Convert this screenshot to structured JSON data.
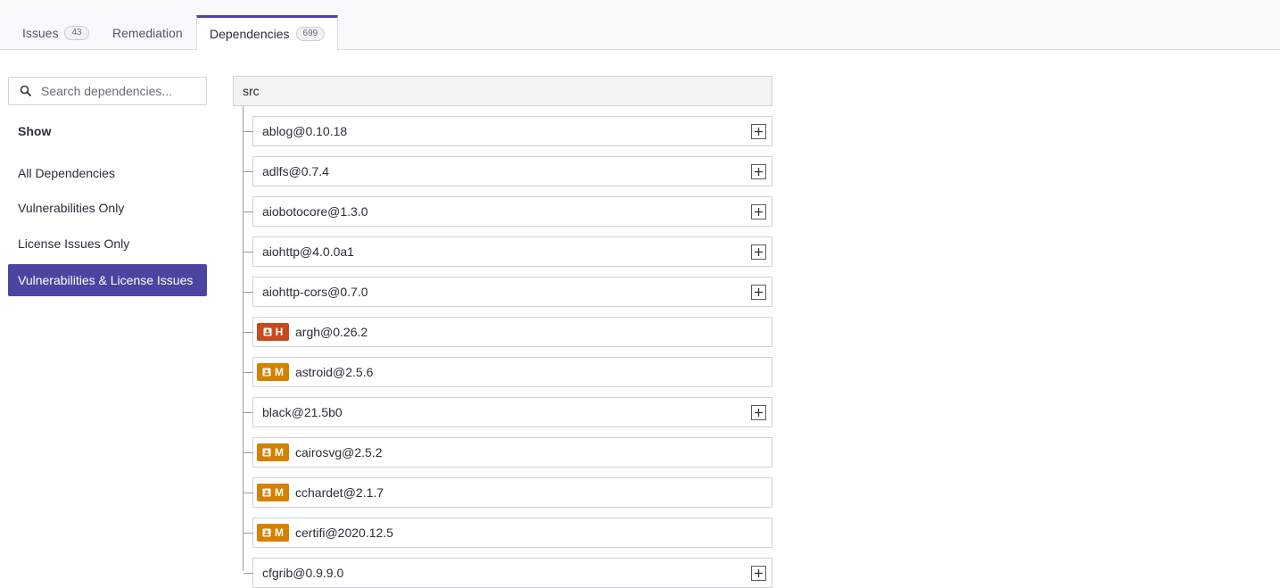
{
  "tabs": {
    "issues": {
      "label": "Issues",
      "count": "43"
    },
    "remediation": {
      "label": "Remediation"
    },
    "dependencies": {
      "label": "Dependencies",
      "count": "699"
    }
  },
  "sidebar": {
    "search_placeholder": "Search dependencies...",
    "show_title": "Show",
    "filters": [
      {
        "label": "All Dependencies"
      },
      {
        "label": "Vulnerabilities Only"
      },
      {
        "label": "License Issues Only"
      },
      {
        "label": "Vulnerabilities & License Issues"
      }
    ],
    "selected_filter": "Vulnerabilities & License Issues"
  },
  "tree": {
    "root": "src",
    "items": [
      {
        "name": "ablog@0.10.18",
        "expandable": true
      },
      {
        "name": "adlfs@0.7.4",
        "expandable": true
      },
      {
        "name": "aiobotocore@1.3.0",
        "expandable": true
      },
      {
        "name": "aiohttp@4.0.0a1",
        "expandable": true
      },
      {
        "name": "aiohttp-cors@0.7.0",
        "expandable": true
      },
      {
        "name": "argh@0.26.2",
        "severity": "H"
      },
      {
        "name": "astroid@2.5.6",
        "severity": "M"
      },
      {
        "name": "black@21.5b0",
        "expandable": true
      },
      {
        "name": "cairosvg@2.5.2",
        "severity": "M"
      },
      {
        "name": "cchardet@2.1.7",
        "severity": "M"
      },
      {
        "name": "certifi@2020.12.5",
        "severity": "M"
      },
      {
        "name": "cfgrib@0.9.9.0",
        "expandable": true
      }
    ]
  },
  "colors": {
    "accent": "#4b45a1",
    "severity_high": "#c84b1c",
    "severity_medium": "#d68000"
  },
  "icons": {
    "search": "search-icon",
    "expand": "plus-icon",
    "license": "license-icon"
  }
}
